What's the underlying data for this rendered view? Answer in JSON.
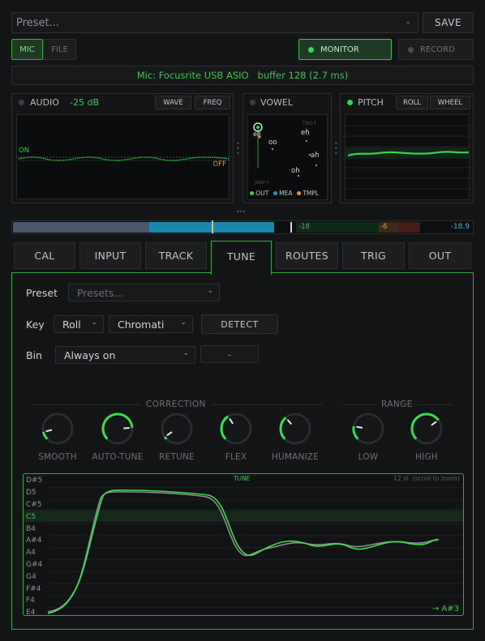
{
  "top_bar": {
    "preset_placeholder": "Preset...",
    "save_label": "SAVE"
  },
  "source": {
    "mic_label": "MIC",
    "file_label": "FILE",
    "monitor_label": "MONITOR",
    "record_label": "RECORD"
  },
  "device_info": {
    "text": "Mic: Focusrite USB ASIO   buffer 128 (2.7 ms)"
  },
  "audio_panel": {
    "title": "AUDIO",
    "level": "-25 dB",
    "wave_label": "WAVE",
    "freq_label": "FREQ",
    "on_label": "ON",
    "off_label": "OFF"
  },
  "vowel_panel": {
    "title": "VOWEL",
    "labels": {
      "ee": "ee",
      "oo": "oo",
      "eh": "eh",
      "ah": "ah",
      "oh": "oh",
      "tng": "TNG↑",
      "jaw": "JAW→"
    },
    "legend": {
      "out": "OUT",
      "mea": "MEA",
      "tmpl": "TMPL"
    }
  },
  "pitch_panel": {
    "title": "PITCH",
    "roll_label": "ROLL",
    "wheel_label": "WHEEL"
  },
  "meter": {
    "mark_18": "-18",
    "mark_6": "-6",
    "peak": "-18.9",
    "level": 0.57
  },
  "tabs": [
    {
      "label": "CAL"
    },
    {
      "label": "INPUT"
    },
    {
      "label": "TRACK"
    },
    {
      "label": "TUNE"
    },
    {
      "label": "ROUTES"
    },
    {
      "label": "TRIG"
    },
    {
      "label": "OUT"
    }
  ],
  "tune": {
    "preset_label": "Preset",
    "preset_placeholder": "Presets...",
    "key_label": "Key",
    "key_value": "Roll",
    "scale_value": "Chromati",
    "detect_label": "DETECT",
    "bin_label": "Bin",
    "bin_value": "Always on",
    "bin_extra": "-",
    "correction_label": "CORRECTION",
    "range_label": "RANGE",
    "knobs": [
      {
        "label": "SMOOTH",
        "value": 0.12
      },
      {
        "label": "AUTO-TUNE",
        "value": 0.82
      },
      {
        "label": "RETUNE",
        "value": 0.04
      },
      {
        "label": "FLEX",
        "value": 0.38
      },
      {
        "label": "HUMANIZE",
        "value": 0.35
      },
      {
        "label": "LOW",
        "value": 0.2
      },
      {
        "label": "HIGH",
        "value": 0.7
      }
    ],
    "graph": {
      "title": "TUNE",
      "zoom_hint": "12 st  (scroll to zoom)",
      "target_note": "→ A#3",
      "highlight_note": "C5",
      "notes": [
        "D#5",
        "D5",
        "C#5",
        "C5",
        "B4",
        "A#4",
        "A4",
        "G#4",
        "G4",
        "F#4",
        "F4",
        "E4"
      ]
    }
  },
  "colors": {
    "accent": "#3ddc4f",
    "panel_border": "#2c2f32",
    "cyan": "#1e8fb3",
    "orange": "#e0a030"
  }
}
